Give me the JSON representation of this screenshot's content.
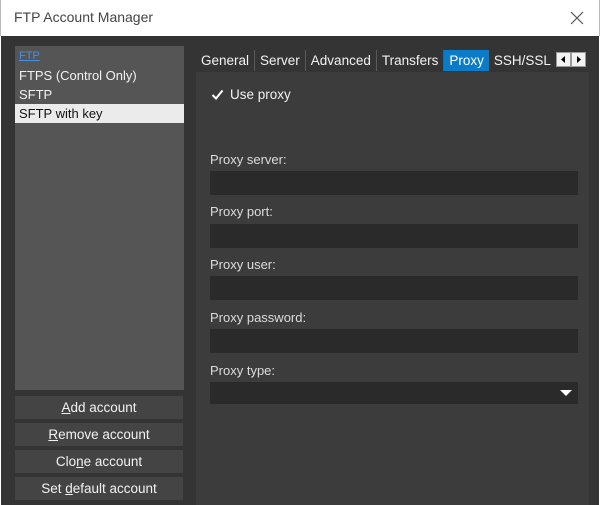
{
  "window": {
    "title": "FTP Account Manager"
  },
  "accounts": [
    {
      "label": "FTP"
    },
    {
      "label": "FTPS (Control Only)"
    },
    {
      "label": "SFTP"
    },
    {
      "label": "SFTP with key"
    }
  ],
  "selected_account": "SFTP with key",
  "buttons": {
    "add": {
      "before": "",
      "key": "A",
      "after": "dd account"
    },
    "remove": {
      "before": "",
      "key": "R",
      "after": "emove account"
    },
    "clone": {
      "before": "Clo",
      "key": "n",
      "after": "e account"
    },
    "set_default": {
      "before": "Set ",
      "key": "d",
      "after": "efault account"
    }
  },
  "tabs": [
    {
      "label": "General"
    },
    {
      "label": "Server"
    },
    {
      "label": "Advanced"
    },
    {
      "label": "Transfers"
    },
    {
      "label": "Proxy"
    },
    {
      "label": "SSH/SSL"
    }
  ],
  "active_tab": "Proxy",
  "proxy": {
    "use_proxy_label": "Use proxy",
    "use_proxy_checked": true,
    "server_label": "Proxy server:",
    "server_value": "",
    "port_label": "Proxy port:",
    "port_value": "",
    "user_label": "Proxy user:",
    "user_value": "",
    "password_label": "Proxy password:",
    "password_value": "",
    "type_label": "Proxy type:",
    "type_value": ""
  },
  "icons": {
    "close": "close-icon",
    "checkmark": "checkmark-icon",
    "scroll_left": "arrow-left-icon",
    "scroll_right": "arrow-right-icon",
    "dropdown": "triangle-down-icon"
  },
  "colors": {
    "background": "#343434",
    "panel": "#3c3c3c",
    "list": "#555555",
    "input": "#2a2a2a",
    "button": "#444444",
    "active_tab": "#0a7cc7",
    "selection": "#ebebeb",
    "link": "#4a90e2"
  }
}
